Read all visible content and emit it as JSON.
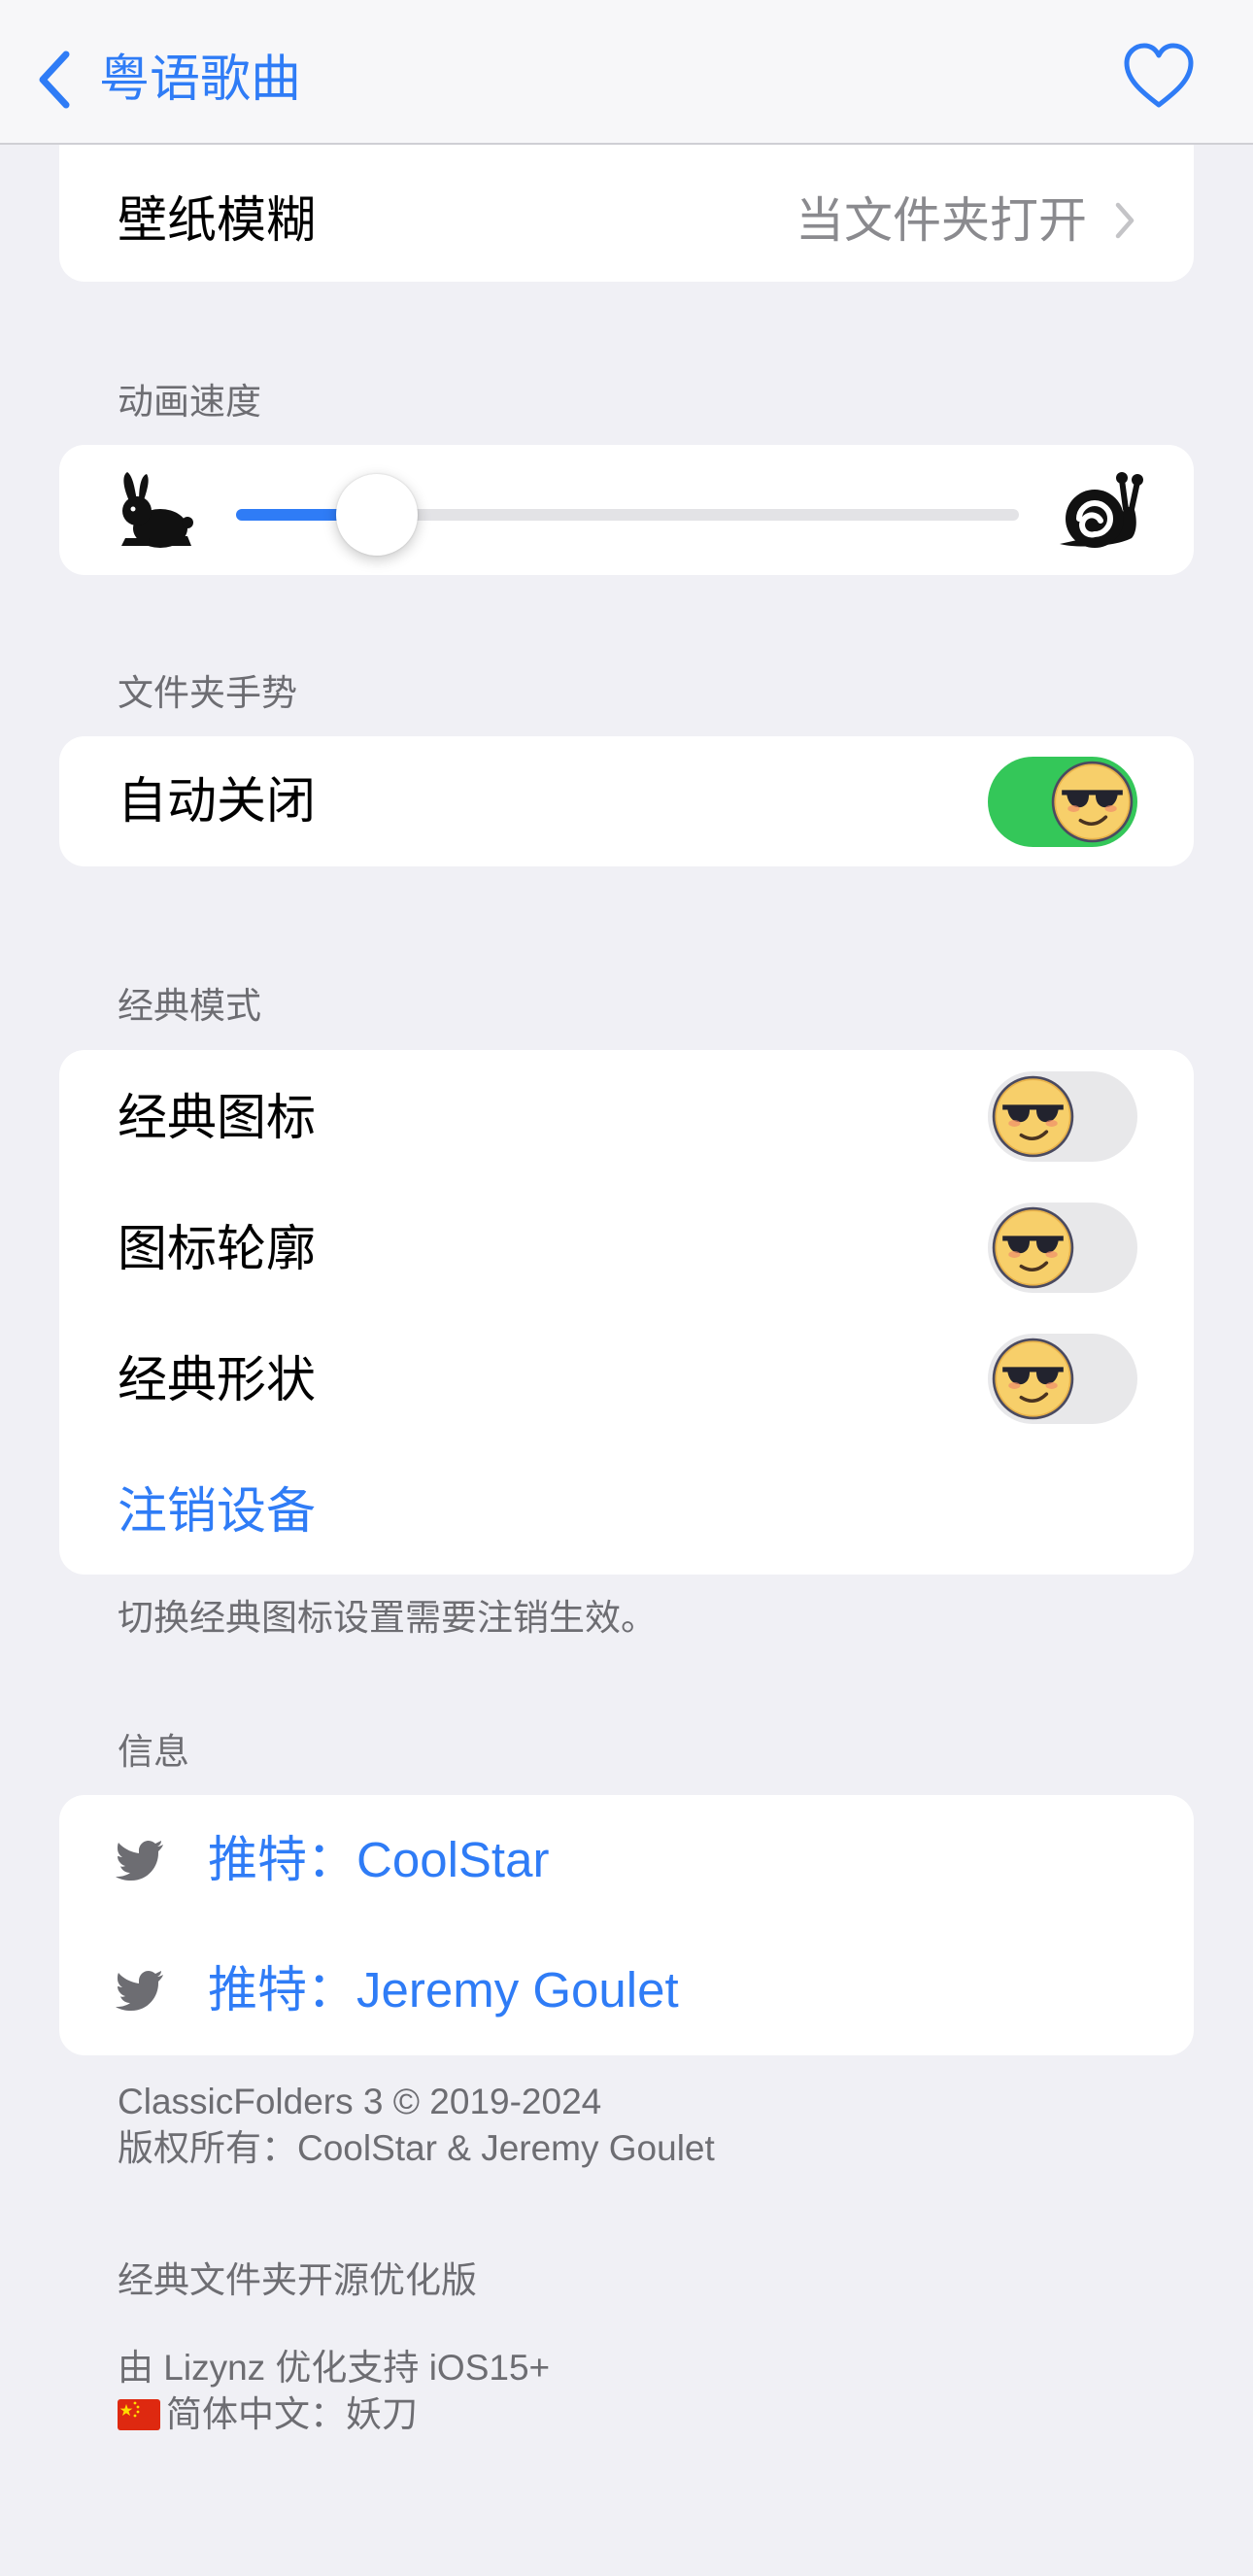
{
  "nav": {
    "back_label": "粤语歌曲",
    "back_icon": "chevron-left-icon",
    "favorite_icon": "heart-icon",
    "accent_color": "#2f7cf6"
  },
  "wallpaper_blur": {
    "label": "壁纸模糊",
    "value": "当文件夹打开"
  },
  "animation_speed": {
    "header": "动画速度",
    "slider_value_fraction": 0.18,
    "left_icon": "rabbit-icon",
    "right_icon": "snail-icon"
  },
  "folder_gesture": {
    "header": "文件夹手势",
    "auto_close": {
      "label": "自动关闭",
      "on": true
    }
  },
  "classic_mode": {
    "header": "经典模式",
    "classic_icons": {
      "label": "经典图标",
      "on": false
    },
    "icon_outline": {
      "label": "图标轮廓",
      "on": false
    },
    "classic_shape": {
      "label": "经典形状",
      "on": false
    },
    "logout_label": "注销设备",
    "footer": "切换经典图标设置需要注销生效。"
  },
  "info": {
    "header": "信息",
    "twitter_prefix": "推特：",
    "links": [
      {
        "name": "CoolStar",
        "icon": "twitter-icon"
      },
      {
        "name": "Jeremy Goulet",
        "icon": "twitter-icon"
      }
    ],
    "copyright_line1": "ClassicFolders 3 © 2019-2024",
    "copyright_line2": "版权所有：CoolStar & Jeremy Goulet"
  },
  "opensource": {
    "header": "经典文件夹开源优化版",
    "line1": "由 Lizynz 优化支持 iOS15+",
    "line2": "简体中文：妖刀",
    "flag_icon": "china-flag-icon"
  },
  "colors": {
    "toggle_on": "#34c759",
    "toggle_off": "#e8e8ea",
    "background": "#f0f0f5"
  }
}
